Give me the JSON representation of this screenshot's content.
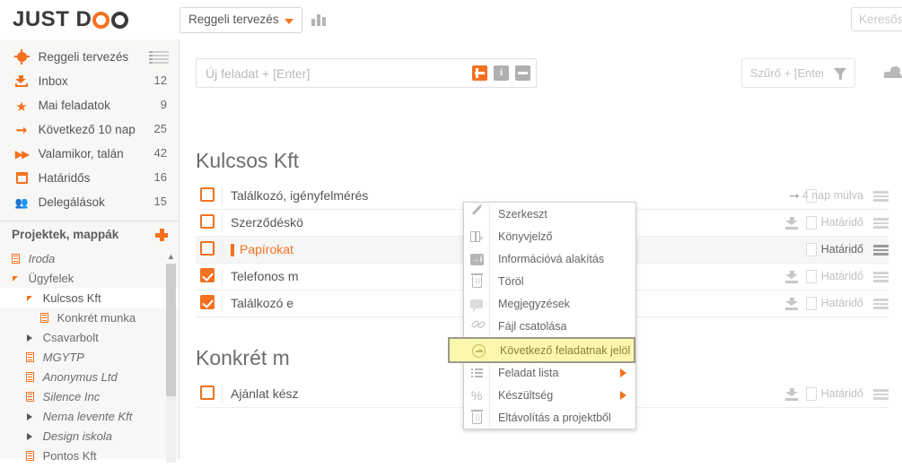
{
  "brand": {
    "text_before": "JUST D",
    "text_after": "O",
    "accent": "#f4711f"
  },
  "topbar": {
    "project_selector": "Reggeli tervezés",
    "chart_icon": "bar-chart-icon",
    "search_placeholder": "Keresős"
  },
  "sidebar": {
    "nav": [
      {
        "label": "Reggeli tervezés",
        "count": "",
        "icon": "sun-icon"
      },
      {
        "label": "Inbox",
        "count": "12",
        "icon": "inbox-icon"
      },
      {
        "label": "Mai feladatok",
        "count": "9",
        "icon": "star-icon"
      },
      {
        "label": "Következő 10 nap",
        "count": "25",
        "icon": "arrow-right-icon"
      },
      {
        "label": "Valamikor, talán",
        "count": "42",
        "icon": "fast-forward-icon"
      },
      {
        "label": "Határidős",
        "count": "16",
        "icon": "calendar-icon"
      },
      {
        "label": "Delegálások",
        "count": "15",
        "icon": "people-icon"
      }
    ],
    "projects_header": "Projektek, mappák",
    "add_label": "+",
    "tree": [
      {
        "label": "Iroda",
        "indent": 0,
        "icon": "doc-icon",
        "italic": true,
        "selected": false
      },
      {
        "label": "Ügyfelek",
        "indent": 0,
        "icon": "triangle-down-icon",
        "italic": false,
        "selected": false
      },
      {
        "label": "Kulcsos Kft",
        "indent": 1,
        "icon": "triangle-down-icon",
        "italic": false,
        "selected": true
      },
      {
        "label": "Konkrét munka",
        "indent": 2,
        "icon": "doc-icon",
        "italic": false,
        "selected": false
      },
      {
        "label": "Csavarbolt",
        "indent": 1,
        "icon": "triangle-right-icon",
        "italic": false,
        "selected": false
      },
      {
        "label": "MGYTP",
        "indent": 1,
        "icon": "doc-icon",
        "italic": true,
        "selected": false
      },
      {
        "label": "Anonymus Ltd",
        "indent": 1,
        "icon": "doc-icon",
        "italic": true,
        "selected": false
      },
      {
        "label": "Silence Inc",
        "indent": 1,
        "icon": "doc-icon",
        "italic": true,
        "selected": false
      },
      {
        "label": "Nema levente Kft",
        "indent": 1,
        "icon": "triangle-right-icon",
        "italic": true,
        "selected": false
      },
      {
        "label": "Design iskola",
        "indent": 1,
        "icon": "triangle-right-icon",
        "italic": true,
        "selected": false
      },
      {
        "label": "Pontos Kft",
        "indent": 1,
        "icon": "doc-icon",
        "italic": false,
        "selected": false
      }
    ]
  },
  "main": {
    "new_task_placeholder": "Új feladat + [Enter]",
    "new_task_buttons": {
      "add": "add-icon",
      "info": "i",
      "collapse": "minus-icon"
    },
    "filter_placeholder": "Szűrő + [Enter]",
    "groups": [
      {
        "title": "Kulcsos Kft",
        "rows": [
          {
            "text": "Találkozó, igényfelmérés",
            "checked": false,
            "is_next": false,
            "due": "4 nap múlva",
            "highlighted": false,
            "lead_icon": "arrow-right-icon"
          },
          {
            "text": "Szerződéskö",
            "checked": false,
            "is_next": false,
            "due": "Határidő",
            "highlighted": false,
            "lead_icon": "download-icon"
          },
          {
            "text": "Papírokat",
            "checked": false,
            "is_next": true,
            "due": "Határidő",
            "highlighted": true,
            "lead_icon": ""
          },
          {
            "text": "Telefonos m",
            "checked": true,
            "is_next": false,
            "due": "Határidő",
            "highlighted": false,
            "lead_icon": "download-icon"
          },
          {
            "text": "Találkozó e",
            "checked": true,
            "is_next": false,
            "due": "Határidő",
            "highlighted": false,
            "lead_icon": "download-icon"
          }
        ]
      },
      {
        "title": "Konkrét m",
        "rows": [
          {
            "text": "Ajánlat kész",
            "checked": false,
            "is_next": false,
            "due": "Határidő",
            "highlighted": false,
            "lead_icon": "download-icon"
          }
        ]
      }
    ]
  },
  "context_menu": {
    "items": [
      {
        "label": "Szerkeszt",
        "icon": "pencil-icon",
        "submenu": false,
        "highlighted": false
      },
      {
        "label": "Könyvjelző",
        "icon": "bookmark-add-icon",
        "submenu": false,
        "highlighted": false
      },
      {
        "label": "Információvá alakítás",
        "icon": "convert-info-icon",
        "submenu": false,
        "highlighted": false
      },
      {
        "label": "Töröl",
        "icon": "trash-icon",
        "submenu": false,
        "highlighted": false
      },
      {
        "label": "Megjegyzések",
        "icon": "comment-icon",
        "submenu": false,
        "highlighted": false
      },
      {
        "label": "Fájl csatolása",
        "icon": "paperclip-icon",
        "submenu": false,
        "highlighted": false
      },
      {
        "label": "Következő feladatnak jelöl",
        "icon": "circle-arrow-icon",
        "submenu": false,
        "highlighted": true
      },
      {
        "label": "Feladat lista",
        "icon": "list-icon",
        "submenu": true,
        "highlighted": false
      },
      {
        "label": "Készültség",
        "icon": "percent-icon",
        "submenu": true,
        "highlighted": false
      },
      {
        "label": "Eltávolítás a projektből",
        "icon": "trash-icon",
        "submenu": false,
        "highlighted": false
      }
    ]
  }
}
